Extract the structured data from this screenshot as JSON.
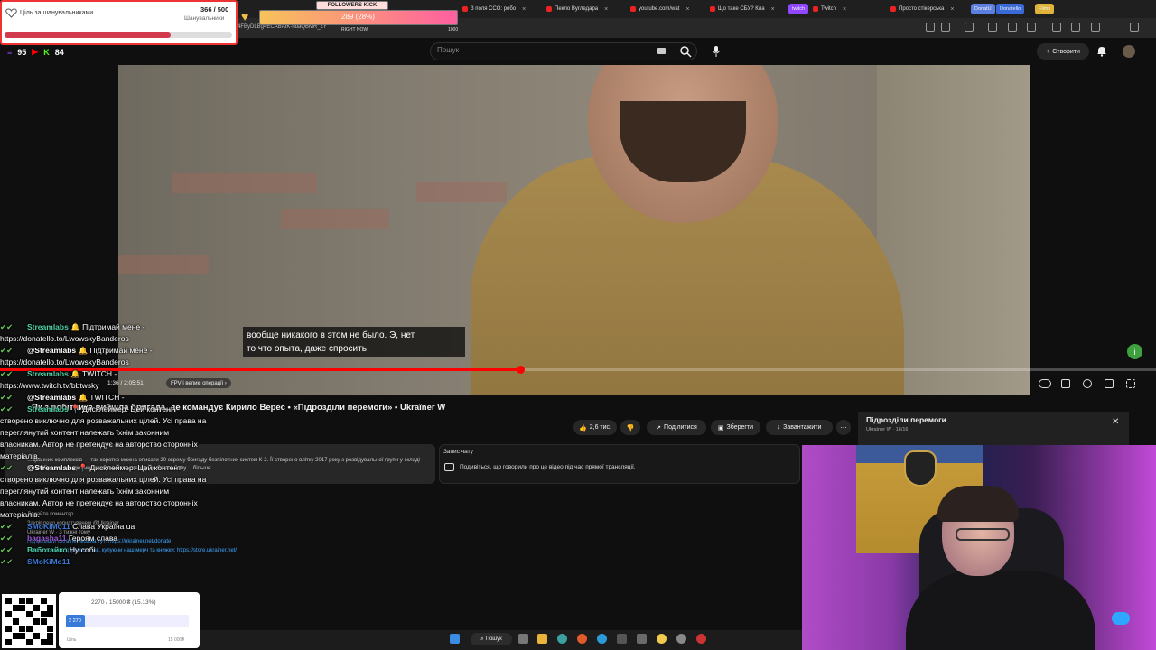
{
  "overlay_goal": {
    "title": "Ціль за шанувальниками",
    "count": "366 / 500",
    "subtitle": "Шанувальники",
    "fraction": 0.732
  },
  "overlay_followers": {
    "header": "FOLLOWERS KICK",
    "value": "289 (28%)",
    "footer": "RIGHT NOW",
    "max": "1000",
    "fraction": 0.28
  },
  "overlay_counters": {
    "first": "95",
    "second": "84"
  },
  "browser": {
    "url": "4FByDLBg4ECABAIK-ndaQBMR_xY",
    "tabs": [
      {
        "label": "З поля ССО: робо"
      },
      {
        "label": "Пекло Вугледара"
      },
      {
        "label": "youtube.com/wat"
      },
      {
        "label": "Що таке СБУ? Кла"
      },
      {
        "label": "Twitch"
      },
      {
        "label": "Просто стікерська"
      }
    ],
    "pills": [
      "twitch",
      "DonatU",
      "Donatello",
      "Films"
    ]
  },
  "youtube": {
    "search_placeholder": "Пошук",
    "create_label": "Створити",
    "subtitle_line1": "вообще никакого в этом не было. Э, нет",
    "subtitle_line2": "то что опыта, даже спросить",
    "time": "1:36 / 2:05:51",
    "chapter": "FPV і великі операції",
    "progress": 0.45,
    "title": "Як з робітника вийшла бригада, де командує Кирило Верес • «Підрозділи перемоги» • Ukraїner W",
    "likes": "2,6 тис.",
    "share": "Поділитися",
    "save": "Зберегти",
    "download": "Завантажити",
    "description": "…дванних комплексів — так коротко можна описати 20 окрему бригаду безпілотних систем К-2. Її створено влітку 2017 року з розвідувальної групи у складі 92 ОШБр, яка швидко масштабувалася: спершу до батальйону …більше",
    "chat_replay_title": "Запис чату",
    "chat_replay_text": "Подивіться, що говорили про це відео під час прямої трансляції.",
    "comments_lines": [
      "Додайте коментар…",
      "Закріплено користувачем @Ukrainer",
      "Ukrainer W · 3 тижні тому",
      "Підтримати Ukraїner можна тут: https://ukrainer.net/donate",
      "Також можна підтримати так, купуючи наш мерч та книжки: https://store.ukrainer.net/"
    ]
  },
  "playlist": {
    "title": "Підрозділи перемоги",
    "subtitle": "Ukraїner W · 16/16"
  },
  "chat": [
    {
      "nick": "Streamlabs",
      "nick_color": "#4fd1a5",
      "text": "🔔 Підтримай мене - https://donatello.to/LwowskyBanderos"
    },
    {
      "nick": "@Streamlabs",
      "nick_color": "#fff",
      "text": "🔔 Підтримай мене - https://donatello.to/LwowskyBanderos"
    },
    {
      "nick": "Streamlabs",
      "nick_color": "#4fd1a5",
      "text": "🔔 TWITCH - https://www.twitch.tv/bbtwsky"
    },
    {
      "nick": "@Streamlabs",
      "nick_color": "#fff",
      "text": "🔔 TWITCH -"
    },
    {
      "nick": "Streamlabs",
      "nick_color": "#4fd1a5",
      "text": "📍 Дисклеймер: Цей контент створено виключно для розважальних цілей. Усі права на переглянутий контент належать їхнім законним власникам. Автор не претендує на авторство сторонніх матеріалів."
    },
    {
      "nick": "@Streamlabs",
      "nick_color": "#fff",
      "text": "📍 Дисклеймер: Цей контент створено виключно для розважальних цілей. Усі права на переглянутий контент належать їхнім законним власникам. Автор не претендує на авторство сторонніх матеріалів."
    },
    {
      "nick": "SMoKiMo11",
      "nick_color": "#3e7bd8",
      "text": "Слава Україна ua"
    },
    {
      "nick": "bagasha11",
      "nick_color": "#9b59d0",
      "text": "Героям слава"
    },
    {
      "nick": "Ваботайко",
      "nick_color": "#4fd1a5",
      "text": "Ну собі"
    },
    {
      "nick": "SMoKiMo11",
      "nick_color": "#3e7bd8",
      "text": ""
    }
  ],
  "donation": {
    "label": "2270 / 15000 ₴ (15.13%)",
    "fill_label": "2 270",
    "fraction": 0.1513,
    "min_label": "Ціль",
    "max_label": "15 000₴"
  },
  "taskbar": {
    "search_label": "Пошук"
  },
  "colors": {
    "accent_red": "#ff0000",
    "youtube_bg": "#0f0f0f"
  }
}
